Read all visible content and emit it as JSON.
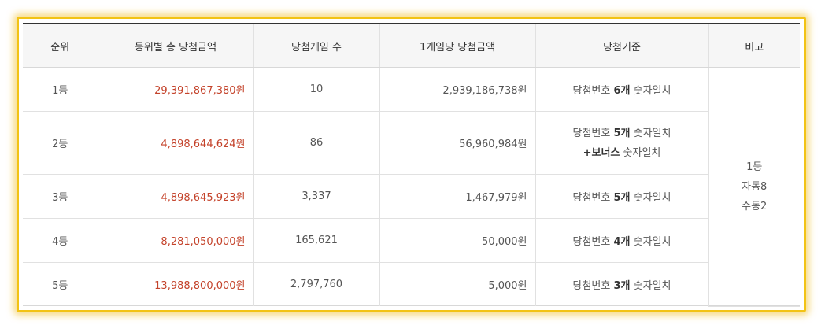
{
  "headers": {
    "rank": "순위",
    "total": "등위별 총 당첨금액",
    "games": "당첨게임 수",
    "per_game": "1게임당 당첨금액",
    "criteria": "당첨기준",
    "note": "비고"
  },
  "rows": [
    {
      "rank": "1등",
      "total": "29,391,867,380원",
      "games": "10",
      "per_game": "2,939,186,738원",
      "crit_pre": "당첨번호 ",
      "crit_bold": "6개",
      "crit_post": " 숫자일치"
    },
    {
      "rank": "2등",
      "total": "4,898,644,624원",
      "games": "86",
      "per_game": "56,960,984원",
      "crit_pre": "당첨번호 ",
      "crit_bold": "5개",
      "crit_post": " 숫자일치",
      "crit2_bold": "+보너스",
      "crit2_post": " 숫자일치"
    },
    {
      "rank": "3등",
      "total": "4,898,645,923원",
      "games": "3,337",
      "per_game": "1,467,979원",
      "crit_pre": "당첨번호 ",
      "crit_bold": "5개",
      "crit_post": " 숫자일치"
    },
    {
      "rank": "4등",
      "total": "8,281,050,000원",
      "games": "165,621",
      "per_game": "50,000원",
      "crit_pre": "당첨번호 ",
      "crit_bold": "4개",
      "crit_post": " 숫자일치"
    },
    {
      "rank": "5등",
      "total": "13,988,800,000원",
      "games": "2,797,760",
      "per_game": "5,000원",
      "crit_pre": "당첨번호 ",
      "crit_bold": "3개",
      "crit_post": " 숫자일치"
    }
  ],
  "note": {
    "line1": "1등",
    "line2": "자동8",
    "line3": "수동2"
  },
  "colors": {
    "frame": "#f2c315",
    "amount_red": "#c4432b",
    "header_bg": "#f6f6f6"
  }
}
